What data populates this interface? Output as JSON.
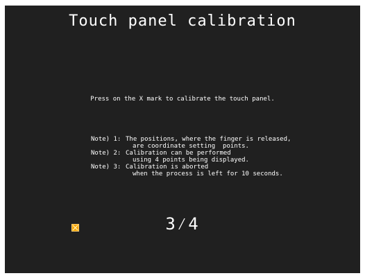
{
  "screen": {
    "title": "Touch panel calibration",
    "instruction": "Press on the X mark to calibrate the touch panel.",
    "notes": [
      {
        "prefix": "Note) 1:",
        "line1": "The positions, where the finger is released,",
        "line2": "are coordinate setting  points."
      },
      {
        "prefix": "Note) 2:",
        "line1": "Calibration can be performed",
        "line2": "using 4 points being displayed."
      },
      {
        "prefix": "Note) 3:",
        "line1": "Calibration is aborted",
        "line2": "when the process is left for 10 seconds."
      }
    ],
    "progress": "3⁄4",
    "progress_current": 3,
    "progress_total": 4,
    "x_mark_icon": "x-mark-icon",
    "colors": {
      "background": "#202020",
      "text": "#ffffff",
      "x_mark": "#f5a300"
    }
  }
}
